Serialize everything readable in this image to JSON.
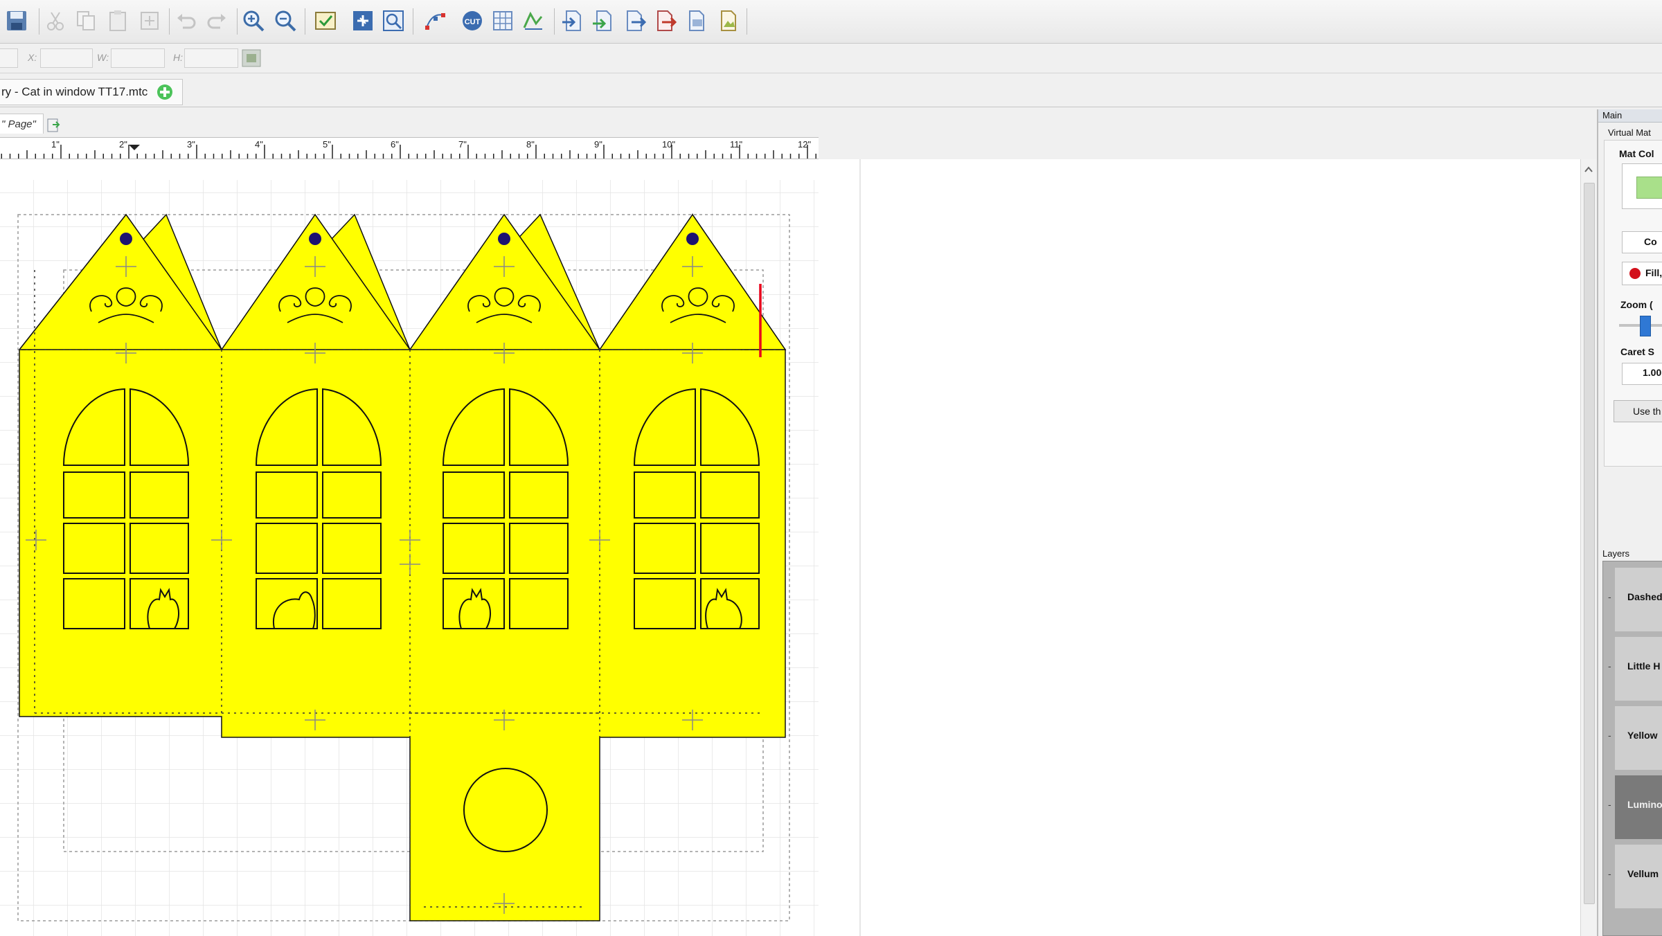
{
  "toolbar": {
    "buttons": [
      "save",
      "cut",
      "copy",
      "paste",
      "duplicate",
      "undo",
      "redo",
      "zoom-in",
      "zoom-out",
      "check",
      "select-all",
      "zoom-select",
      "node-edit",
      "cut-send",
      "grid",
      "trace",
      "import-1",
      "import-2",
      "import-3",
      "import-4",
      "import-5",
      "import-6"
    ]
  },
  "coords": {
    "x_label": "X:",
    "w_label": "W:",
    "h_label": "H:"
  },
  "document_tab": {
    "label": "ry - Cat in window TT17.mtc"
  },
  "page_tab": {
    "label": "\" Page\""
  },
  "ruler": {
    "ticks": [
      "1\"",
      "2\"",
      "3\"",
      "4\"",
      "5\"",
      "6\"",
      "7\"",
      "8\"",
      "9\"",
      "10\"",
      "11\"",
      "12\""
    ]
  },
  "right_panel": {
    "header": "Main",
    "subtab": "Virtual Mat",
    "mat_color_label": "Mat Col",
    "cont_button": "Co",
    "fill_label": "Fill,",
    "zoom_label": "Zoom (",
    "caret_label": "Caret S",
    "caret_value": "1.00",
    "use_button": "Use th",
    "layers_header": "Layers",
    "layers": [
      "Dashed",
      "Little H",
      "Yellow",
      "Lumino",
      "Vellum"
    ]
  },
  "colors": {
    "shape_fill": "#ffff00",
    "hole": "#1c1270",
    "cut_line": "#e8001c",
    "accent_green": "#29b34a"
  }
}
